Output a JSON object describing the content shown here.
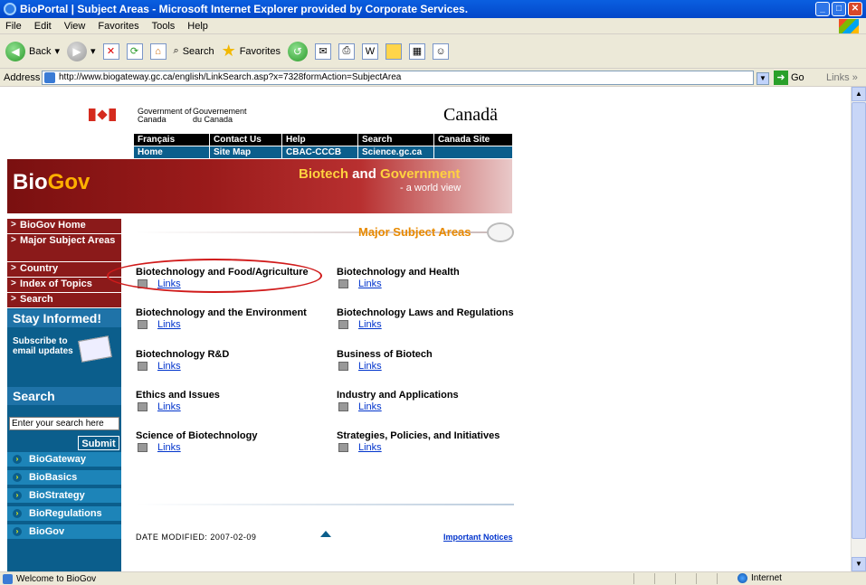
{
  "window": {
    "title": "BioPortal | Subject Areas - Microsoft Internet Explorer provided by Corporate Services."
  },
  "menu": [
    "File",
    "Edit",
    "View",
    "Favorites",
    "Tools",
    "Help"
  ],
  "toolbar": {
    "back": "Back",
    "search": "Search",
    "favorites": "Favorites"
  },
  "address": {
    "label": "Address",
    "url": "http://www.biogateway.gc.ca/english/LinkSearch.asp?x=7328formAction=SubjectArea",
    "go": "Go",
    "links": "Links"
  },
  "goc": {
    "en": "Government of Canada",
    "fr": "Gouvernement du Canada",
    "wordmark": "Canadä"
  },
  "nav_top": [
    "Français",
    "Contact Us",
    "Help",
    "Search",
    "Canada Site"
  ],
  "nav_bottom": [
    "Home",
    "Site Map",
    "CBAC-CCCB",
    "Science.gc.ca"
  ],
  "banner": {
    "bio": "Bio",
    "gov": "Gov",
    "tag_bio": "Biotech",
    "tag_and": " and ",
    "tag_gov": "Government",
    "sub": "- a world view"
  },
  "sidebar": {
    "items": [
      "BioGov Home",
      "Major Subject Areas",
      "Country",
      "Index of Topics",
      "Search"
    ],
    "stay": "Stay Informed!",
    "subscribe": "Subscribe to email updates",
    "search_head": "Search",
    "search_value": "Enter your search here",
    "submit": "Submit",
    "links": [
      "BioGateway",
      "BioBasics",
      "BioStrategy",
      "BioRegulations",
      "BioGov"
    ]
  },
  "main": {
    "heading": "Major Subject Areas",
    "link_label": "Links",
    "subjects_left": [
      "Biotechnology and Food/Agriculture",
      "Biotechnology and the Environment",
      "Biotechnology R&D",
      "Ethics and Issues",
      "Science of Biotechnology"
    ],
    "subjects_right": [
      "Biotechnology and Health",
      "Biotechnology Laws and Regulations",
      "Business of Biotech",
      "Industry and Applications",
      "Strategies, Policies, and Initiatives"
    ],
    "date_modified": "DATE MODIFIED:  2007-02-09",
    "notices": "Important Notices"
  },
  "status": {
    "text": "Welcome to BioGov",
    "zone": "Internet"
  }
}
